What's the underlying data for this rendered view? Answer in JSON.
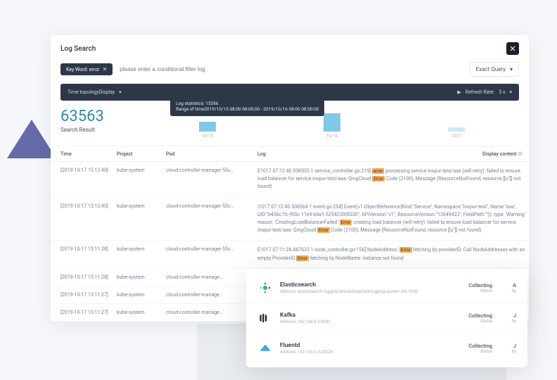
{
  "header": {
    "title": "Log Search"
  },
  "filter": {
    "chip_label": "Key Word: error",
    "input_placeholder": "please enter a conditional filter log",
    "exact_query_label": "Exact Query"
  },
  "toolbar": {
    "time_label": "Time topologyDisplay",
    "refresh_label": "Refresh Rate:",
    "refresh_value": "5 s"
  },
  "stats": {
    "count": "63563",
    "count_label": "Search Result",
    "tooltip_line1": "Log statistics: 13356",
    "tooltip_line2": "Range of time2019/10/15 08:00 08:00:00 - 2019/10/16 08:00 08:00:00"
  },
  "chart_data": {
    "type": "bar",
    "categories": [
      "10/15",
      "10/16",
      "10/17"
    ],
    "values": [
      8000,
      13356,
      2200
    ],
    "title": "",
    "xlabel": "",
    "ylabel": "",
    "ylim": [
      0,
      15000
    ]
  },
  "columns": {
    "time": "Time",
    "project": "Project",
    "pod": "Pod",
    "log": "Log",
    "display": "Display content"
  },
  "rows": [
    {
      "time": "[2019-10-17 15:12:40]",
      "project": "kube-system",
      "pod": "cloud-controller-manager-55c…",
      "log_parts": [
        "E1017 07:12:40.508505 1 service_controller.go:219] ",
        "error",
        " processing service inspur-test/aaa (will retry): failed to ensure load balancer for service inspur-test/aaa: QingCloud ",
        "Error",
        " Code (2100), Message (ResourceNotFound, resource [[u'']] not found)"
      ]
    },
    {
      "time": "[2019-10-17 15:12:40]",
      "project": "kube-system",
      "pod": "cloud-controller-manager-55c…",
      "log_parts": [
        "I1017 07:12:40.508564 1 event.go:258] Event(v1.ObjectReference{Kind:\"Service\", Namespace:\"inspur-test\", Name:\"aaa\", UID:\"b456c7fc-f00c-11e9-b4a1-5254230f8320\", APIVersion:\"v1\", ResourceVersion:\"13649423\", FieldPath:\"\"}): type: 'Warning' reason: 'CreatingLoadBalancerFailed' ",
        "Error",
        " creating load balancer (will retry): failed to ensure load balancer for service inspur-test/aaa: QingCloud ",
        "Error",
        " Code (2100), Message (ResourceNotFound, resource [[u'']] not found)"
      ]
    },
    {
      "time": "[2019-10-17 15:11:28]",
      "project": "kube-system",
      "pod": "cloud-controller-manager-55c…",
      "log_parts": [
        "E1017 07:11:28.487633 1 node_controller.go:156] NodeAddress: ",
        "Error",
        " fetching by providerID: Call NodeAddresses with an empty ProviderID ",
        "Error",
        " fetching by NodeName: instance not found"
      ]
    },
    {
      "time": "[2019-10-17 15:11:28]",
      "project": "kube-system",
      "pod": "cloud-controller-manage…",
      "log_parts": []
    },
    {
      "time": "[2019-10-17 15:11:27]",
      "project": "kube-system",
      "pod": "cloud-controller-manage…",
      "log_parts": []
    },
    {
      "time": "[2019-10-17 15:11:27]",
      "project": "kube-system",
      "pod": "cloud-controller-manage…",
      "log_parts": []
    }
  ],
  "services": [
    {
      "name": "Elasticsearch",
      "address": "Address: elasticsearch-logging-data.kubesphere-logging-system.svc:9200",
      "status": "Collecting",
      "status_label": "Status",
      "meta": "A",
      "meta2": "by"
    },
    {
      "name": "Kafka",
      "address": "Address: 192.168.0.5:9092",
      "status": "Collecting",
      "status_label": "Status",
      "meta": "J",
      "meta2": "by"
    },
    {
      "name": "Fluentd",
      "address": "Address: 192.168.0.5:24224",
      "status": "Collecting",
      "status_label": "Status",
      "meta": "J",
      "meta2": "by"
    }
  ]
}
